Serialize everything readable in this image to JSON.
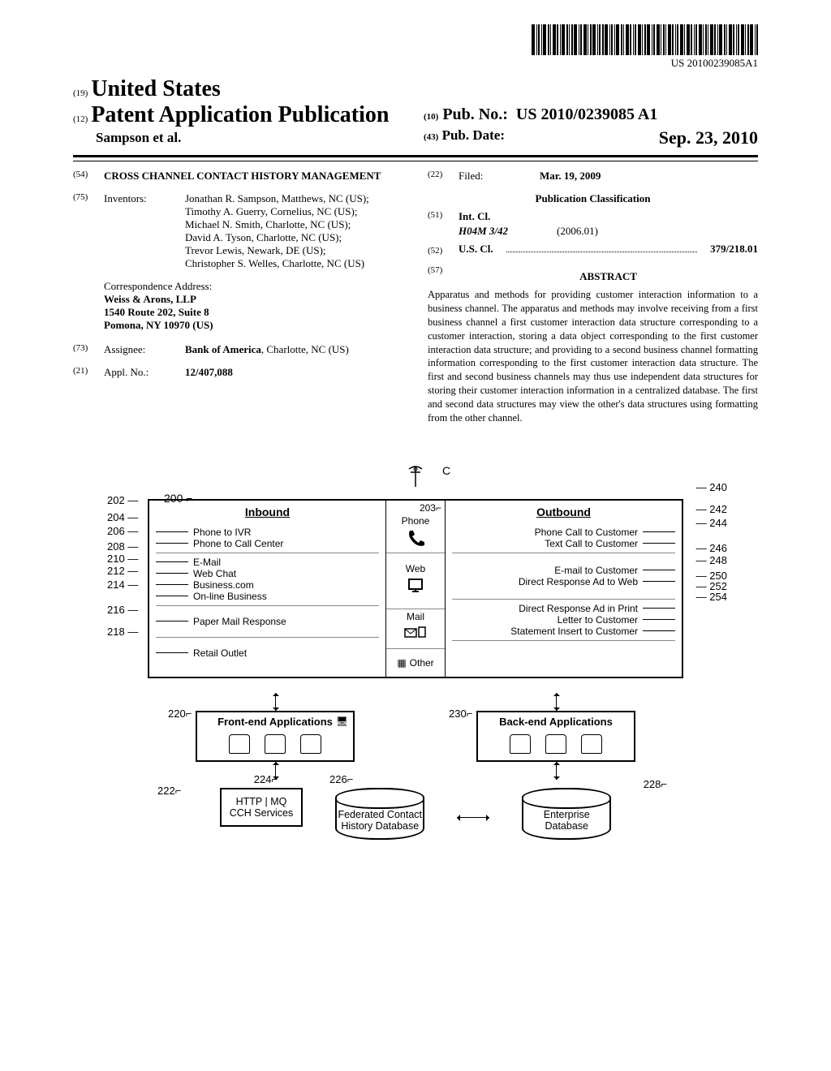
{
  "barcode_text": "US 20100239085A1",
  "header": {
    "code19": "(19)",
    "country": "United States",
    "code12": "(12)",
    "pub_type": "Patent Application Publication",
    "authors_short": "Sampson et al.",
    "code10": "(10)",
    "pubno_label": "Pub. No.:",
    "pubno": "US 2010/0239085 A1",
    "code43": "(43)",
    "pubdate_label": "Pub. Date:",
    "pubdate": "Sep. 23, 2010"
  },
  "bibliography": {
    "code54": "(54)",
    "title": "CROSS CHANNEL CONTACT HISTORY MANAGEMENT",
    "code75": "(75)",
    "inventors_label": "Inventors:",
    "inventors": "Jonathan R. Sampson, Matthews, NC (US); Timothy A. Guerry, Cornelius, NC (US); Michael N. Smith, Charlotte, NC (US); David A. Tyson, Charlotte, NC (US); Trevor Lewis, Newark, DE (US); Christopher S. Welles, Charlotte, NC (US)",
    "corr_label": "Correspondence Address:",
    "corr_lines": [
      "Weiss & Arons, LLP",
      "1540 Route 202, Suite 8",
      "Pomona, NY 10970 (US)"
    ],
    "code73": "(73)",
    "assignee_label": "Assignee:",
    "assignee": "Bank of America, Charlotte, NC (US)",
    "code21": "(21)",
    "applno_label": "Appl. No.:",
    "applno": "12/407,088",
    "code22": "(22)",
    "filed_label": "Filed:",
    "filed": "Mar. 19, 2009",
    "pubclass_head": "Publication Classification",
    "code51": "(51)",
    "intcl_label": "Int. Cl.",
    "intcl_code": "H04M 3/42",
    "intcl_date": "(2006.01)",
    "code52": "(52)",
    "uscl_label": "U.S. Cl.",
    "uscl_value": "379/218.01",
    "code57": "(57)",
    "abstract_head": "ABSTRACT",
    "abstract": "Apparatus and methods for providing customer interaction information to a business channel. The apparatus and methods may involve receiving from a first business channel a first customer interaction data structure corresponding to a customer interaction, storing a data object corresponding to the first customer interaction data structure; and providing to a second business channel formatting information corresponding to the first customer interaction data structure. The first and second business channels may thus use independent data structures for storing their customer interaction information in a centralized database. The first and second data structures may view the other's data structures using formatting from the other channel."
  },
  "figure": {
    "c_label": "C",
    "ref200": "200",
    "ref203": "203",
    "inbound_title": "Inbound",
    "outbound_title": "Outbound",
    "mid_labels": [
      "Phone",
      "Web",
      "Mail",
      "Other"
    ],
    "inbound": {
      "phone": [
        "Phone to IVR",
        "Phone to Call Center"
      ],
      "web": [
        "E-Mail",
        "Web Chat",
        "Business.com",
        "On-line Business"
      ],
      "mail": [
        "Paper Mail Response"
      ],
      "other": [
        "Retail Outlet"
      ]
    },
    "outbound": {
      "phone": [
        "Phone Call to Customer",
        "Text Call to Customer"
      ],
      "web": [
        "E-mail to Customer",
        "Direct Response Ad to Web"
      ],
      "mail": [
        "Direct Response Ad in Print",
        "Letter to Customer",
        "Statement Insert to Customer"
      ]
    },
    "refs_left": {
      "202": "202",
      "204": "204",
      "206": "206",
      "208": "208",
      "210": "210",
      "212": "212",
      "214": "214",
      "216": "216",
      "218": "218"
    },
    "refs_right": {
      "240": "240",
      "242": "242",
      "244": "244",
      "246": "246",
      "248": "248",
      "250": "250",
      "252": "252",
      "254": "254"
    },
    "frontend_ref": "220",
    "frontend_title": "Front-end Applications",
    "backend_ref": "230",
    "backend_title": "Back-end Applications",
    "ref222": "222",
    "ref224": "224",
    "svc_line1": "HTTP | MQ",
    "svc_line2": "CCH Services",
    "ref226": "226",
    "fed_db": "Federated Contact History Database",
    "ref228": "228",
    "ent_db": "Enterprise Database"
  }
}
